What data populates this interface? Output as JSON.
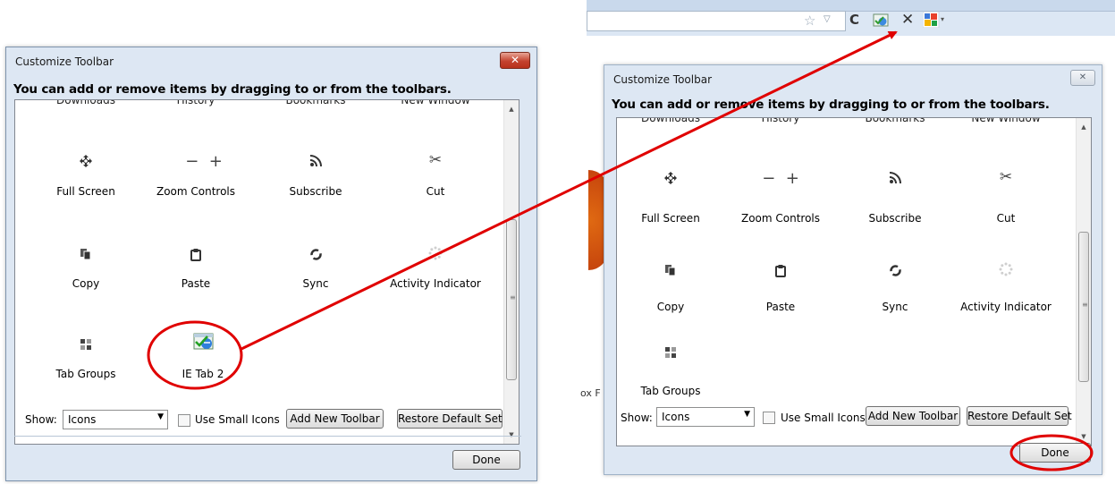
{
  "left_dialog": {
    "title": "Customize Toolbar",
    "instruction": "You can add or remove items by dragging to or from the toolbars.",
    "partial_row": [
      "Downloads",
      "History",
      "Bookmarks",
      "New Window"
    ],
    "items": [
      {
        "label": "Full Screen",
        "icon": "full-screen-icon"
      },
      {
        "label": "Zoom Controls",
        "icon": "zoom-controls-icon"
      },
      {
        "label": "Subscribe",
        "icon": "rss-icon"
      },
      {
        "label": "Cut",
        "icon": "scissors-icon"
      },
      {
        "label": "Copy",
        "icon": "copy-icon"
      },
      {
        "label": "Paste",
        "icon": "paste-icon"
      },
      {
        "label": "Sync",
        "icon": "sync-icon"
      },
      {
        "label": "Activity Indicator",
        "icon": "spinner-icon"
      },
      {
        "label": "Tab Groups",
        "icon": "tab-groups-icon"
      },
      {
        "label": "IE Tab 2",
        "icon": "ie-tab-icon"
      }
    ],
    "show_label": "Show:",
    "show_value": "Icons",
    "small_icons_label": "Use Small Icons",
    "add_toolbar_label": "Add New Toolbar",
    "restore_label": "Restore Default Set",
    "done_label": "Done"
  },
  "right_dialog": {
    "title": "Customize Toolbar",
    "instruction": "You can add or remove items by dragging to or from the toolbars.",
    "partial_row": [
      "Downloads",
      "History",
      "Bookmarks",
      "New Window"
    ],
    "items": [
      {
        "label": "Full Screen",
        "icon": "full-screen-icon"
      },
      {
        "label": "Zoom Controls",
        "icon": "zoom-controls-icon"
      },
      {
        "label": "Subscribe",
        "icon": "rss-icon"
      },
      {
        "label": "Cut",
        "icon": "scissors-icon"
      },
      {
        "label": "Copy",
        "icon": "copy-icon"
      },
      {
        "label": "Paste",
        "icon": "paste-icon"
      },
      {
        "label": "Sync",
        "icon": "sync-icon"
      },
      {
        "label": "Activity Indicator",
        "icon": "spinner-icon"
      },
      {
        "label": "Tab Groups",
        "icon": "tab-groups-icon"
      }
    ],
    "show_label": "Show:",
    "show_value": "Icons",
    "small_icons_label": "Use Small Icons",
    "add_toolbar_label": "Add New Toolbar",
    "restore_label": "Restore Default Set",
    "done_label": "Done"
  },
  "browser_toolbar": {
    "icons": [
      "star-icon",
      "dropdown-icon",
      "reload-icon",
      "ie-tab-icon",
      "stop-icon",
      "google-icon"
    ],
    "partial_text": "ox F"
  },
  "annotation": {
    "highlight_color": "#e00000",
    "arrow_color": "#e00000"
  }
}
